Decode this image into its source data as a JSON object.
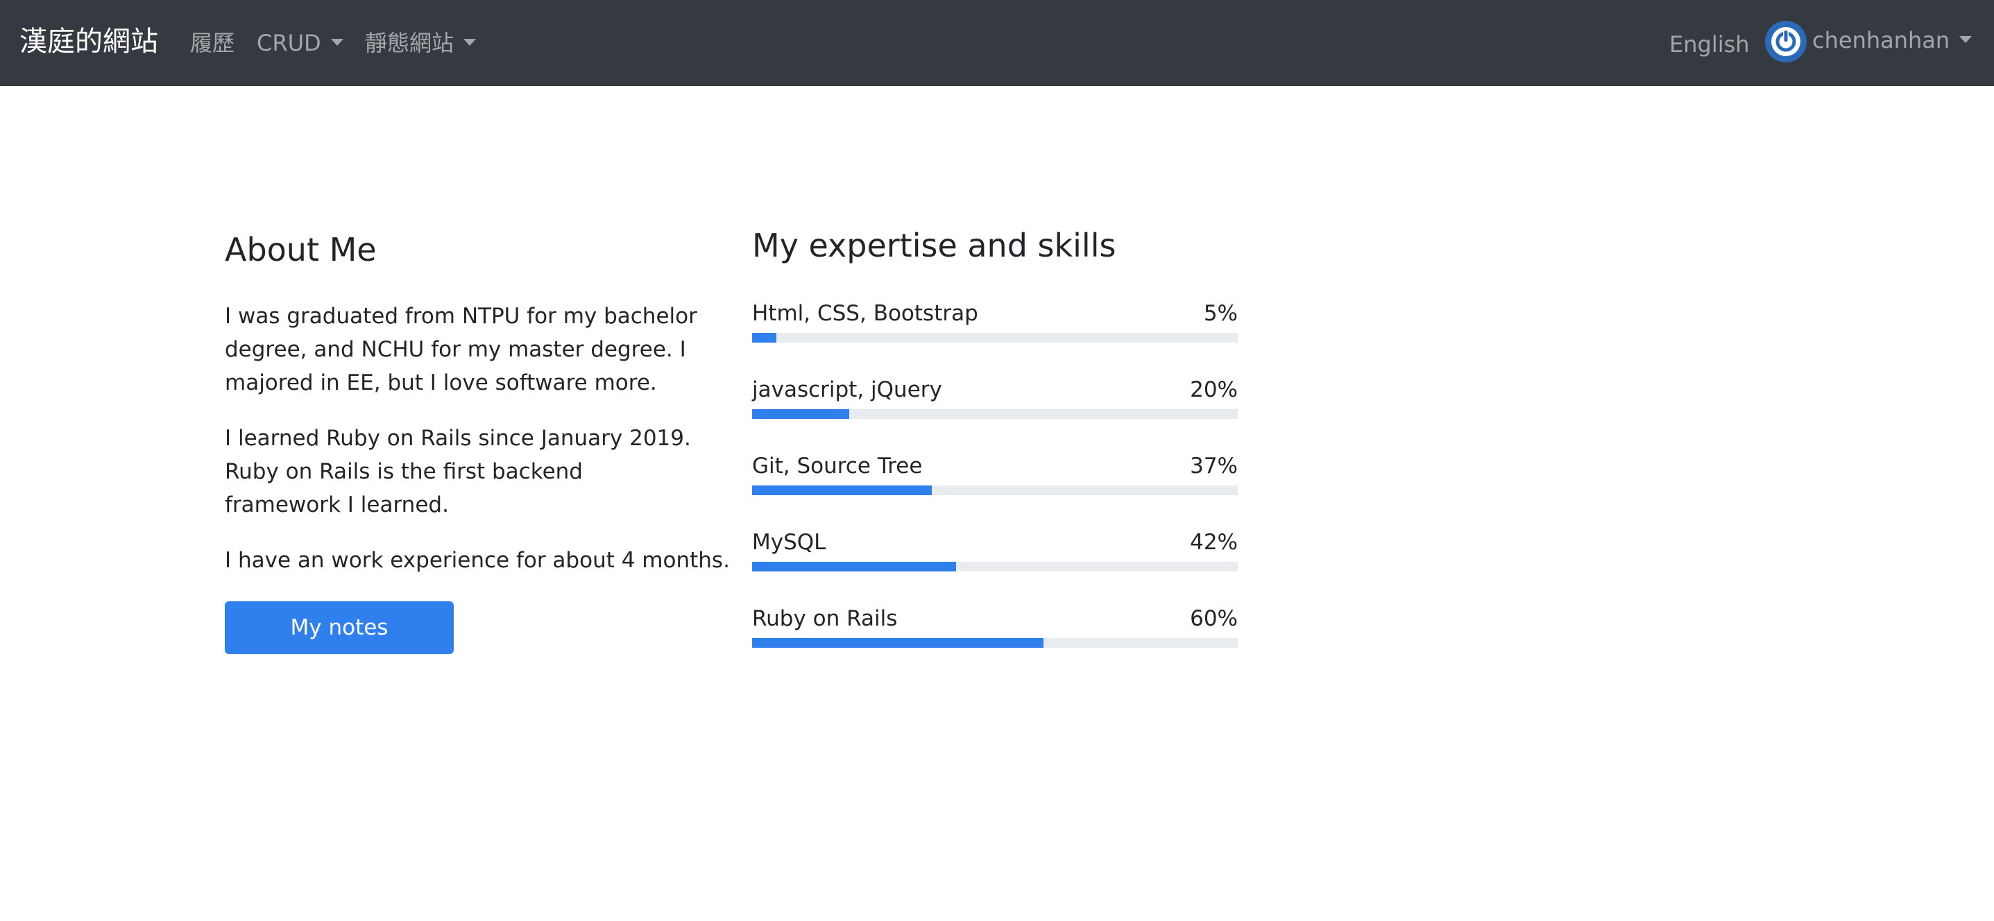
{
  "navbar": {
    "brand": "漢庭的網站",
    "items": [
      {
        "label": "履歷"
      },
      {
        "label": "CRUD"
      },
      {
        "label": "靜態網站"
      }
    ],
    "language": "English",
    "user": "chenhanhan",
    "colors": {
      "background": "#343a40",
      "avatar": "#2a6ab8"
    }
  },
  "about": {
    "title": "About Me",
    "paragraphs": [
      "I was graduated from NTPU for my bachelor degree, and NCHU for my master degree. I majored in EE, but I love software more.",
      "I learned Ruby on Rails since January 2019. Ruby on Rails is the first backend framework I learned.",
      "I have an work experience for about 4 months."
    ],
    "button_label": "My notes"
  },
  "skills": {
    "title": "My expertise and skills",
    "items": [
      {
        "label": "Html, CSS, Bootstrap",
        "percent_text": "5%",
        "value": 5
      },
      {
        "label": "javascript, jQuery",
        "percent_text": "20%",
        "value": 20
      },
      {
        "label": "Git, Source Tree",
        "percent_text": "37%",
        "value": 37
      },
      {
        "label": "MySQL",
        "percent_text": "42%",
        "value": 42
      },
      {
        "label": "Ruby on Rails",
        "percent_text": "60%",
        "value": 60
      }
    ]
  },
  "colors": {
    "accent": "#2f80ed",
    "track": "#e9ecef"
  }
}
